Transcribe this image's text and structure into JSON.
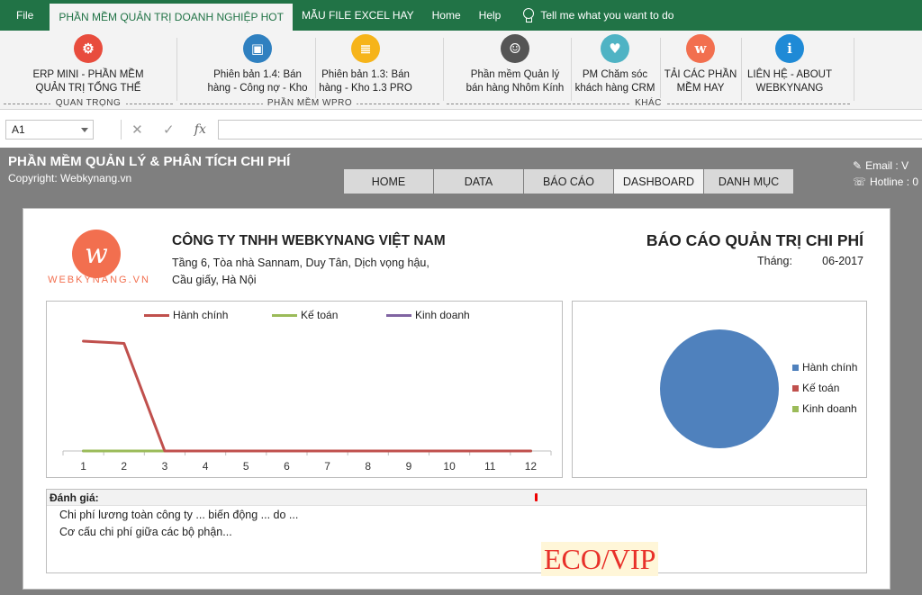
{
  "ribbon_tabs": {
    "file": "File",
    "main": "PHẦN MỀM QUẢN TRỊ DOANH NGHIỆP HOT",
    "excel_templates": "MẪU FILE EXCEL HAY",
    "home": "Home",
    "help": "Help",
    "tell_me": "Tell me what you want to do"
  },
  "ribbon": {
    "buttons": [
      {
        "label1": "ERP MINI - PHẦN MỀM",
        "label2": "QUẢN TRỊ TỔNG THỂ",
        "icon": "erp-icon",
        "color": "#e84c3d",
        "glyph": "⚙"
      },
      {
        "label1": "Phiên bản 1.4: Bán",
        "label2": "hàng - Công nợ - Kho",
        "icon": "sales-monitor-icon",
        "color": "#2f80c0",
        "glyph": "▣"
      },
      {
        "label1": "Phiên bản 1.3: Bán",
        "label2": "hàng - Kho 1.3 PRO",
        "icon": "clipboard-icon",
        "color": "#f6b41a",
        "glyph": "≣"
      },
      {
        "label1": "Phần mềm Quản lý",
        "label2": "bán hàng Nhôm Kính",
        "icon": "consultant-icon",
        "color": "#555555",
        "glyph": "☺"
      },
      {
        "label1": "PM Chăm sóc",
        "label2": "khách hàng CRM",
        "icon": "crm-icon",
        "color": "#4fb3c4",
        "glyph": "♥"
      },
      {
        "label1": "TẢI CÁC PHẦN",
        "label2": "MỀM HAY",
        "icon": "webkynang-logo-icon",
        "color": "#f26f4f",
        "glyph": "w"
      },
      {
        "label1": "LIÊN HỆ - ABOUT",
        "label2": "WEBKYNANG",
        "icon": "about-us-icon",
        "color": "#1f8ad6",
        "glyph": "i"
      }
    ],
    "groups": [
      "QUAN TRỌNG",
      "PHẦN MỀM WPRO",
      "KHÁC"
    ]
  },
  "formula_bar": {
    "cell_ref": "A1",
    "cancel": "✕",
    "enter": "✓",
    "fx": "fx",
    "content": ""
  },
  "app": {
    "title": "PHẦN MỀM QUẢN LÝ & PHÂN TÍCH CHI PHÍ",
    "copyright": "Copyright: Webkynang.vn",
    "nav_tabs": [
      "HOME",
      "DATA",
      "BÁO CÁO",
      "DASHBOARD",
      "DANH MỤC"
    ],
    "active_tab": "DASHBOARD",
    "contact_email": "Email : V",
    "contact_hotline": "Hotline : 0"
  },
  "report": {
    "logo_text": "WEBKYNANG.VN",
    "company": "CÔNG TY TNHH WEBKYNANG VIỆT NAM",
    "address1": "Tầng 6, Tòa nhà Sannam, Duy Tân, Dịch vọng hậu,",
    "address2": "Cầu giấy, Hà Nội",
    "title": "BÁO CÁO QUẢN TRỊ CHI PHÍ",
    "month_label": "Tháng:",
    "month_value": "06-2017"
  },
  "chart_data": [
    {
      "type": "line",
      "title": "",
      "x": [
        1,
        2,
        3,
        4,
        5,
        6,
        7,
        8,
        9,
        10,
        11,
        12
      ],
      "series": [
        {
          "name": "Hành chính",
          "color": "#c0504d",
          "values": [
            100,
            98,
            0,
            0,
            0,
            0,
            0,
            0,
            0,
            0,
            0,
            0
          ]
        },
        {
          "name": "Kế toán",
          "color": "#9bbb59",
          "values": [
            0,
            0,
            0,
            0,
            0,
            0,
            0,
            0,
            0,
            0,
            0,
            0
          ]
        },
        {
          "name": "Kinh doanh",
          "color": "#8064a2",
          "values": [
            0,
            0,
            0,
            0,
            0,
            0,
            0,
            0,
            0,
            0,
            0,
            0
          ]
        }
      ],
      "ylim": [
        0,
        100
      ],
      "grid": false,
      "legend": "top"
    },
    {
      "type": "pie",
      "labels": [
        "Hành chính",
        "Kế toán",
        "Kinh doanh"
      ],
      "values": [
        100,
        0,
        0
      ],
      "colors": [
        "#4f81bd",
        "#c0504d",
        "#9bbb59"
      ],
      "legend": "right"
    }
  ],
  "evaluation": {
    "heading": "Đánh giá:",
    "line1": "Chi phí lương toàn công ty ... biến động ... do ...",
    "line2": "Cơ cấu chi phí giữa các bộ phận...",
    "stamp": "ECO/VIP"
  }
}
